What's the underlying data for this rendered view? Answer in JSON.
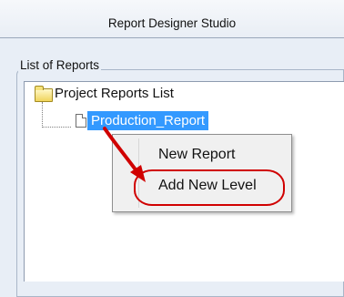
{
  "window": {
    "title": "Report Designer Studio"
  },
  "reports_group": {
    "legend": "List of Reports",
    "tree": {
      "root_label": "Project Reports List",
      "child_label": "Production_Report"
    }
  },
  "context_menu": {
    "items": [
      {
        "label": "New Report"
      },
      {
        "label": "Add New Level"
      }
    ]
  },
  "annotation": {
    "color": "#d00000"
  },
  "colors": {
    "selection": "#3399ff",
    "background": "#e8eef6"
  }
}
